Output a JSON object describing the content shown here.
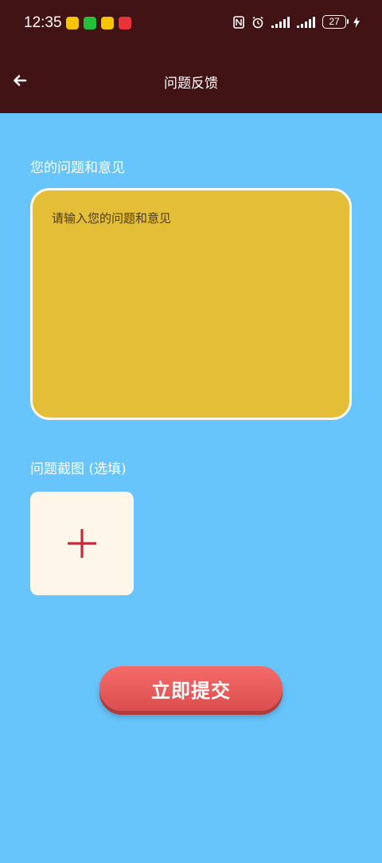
{
  "status_bar": {
    "time": "12:35",
    "battery": "27",
    "app_icons": [
      {
        "name": "meituan-icon",
        "color": "#f7c400"
      },
      {
        "name": "wechat-icon",
        "color": "#22c03b"
      },
      {
        "name": "meituan-icon-2",
        "color": "#f7c400"
      },
      {
        "name": "app-icon-red",
        "color": "#e9333a"
      }
    ]
  },
  "header": {
    "title": "问题反馈",
    "back_icon": "back-arrow-icon"
  },
  "form": {
    "feedback_label": "您的问题和意见",
    "feedback_placeholder": "请输入您的问题和意见",
    "screenshot_label": "问题截图 (选填)",
    "add_icon": "plus-icon",
    "submit_label": "立即提交"
  },
  "colors": {
    "header_bg": "#421314",
    "page_bg": "#67c5fb",
    "textarea_bg": "#e5be37",
    "upload_bg": "#fdf6e9",
    "plus_color": "#c4283d",
    "submit_bg": "#f0605f"
  }
}
